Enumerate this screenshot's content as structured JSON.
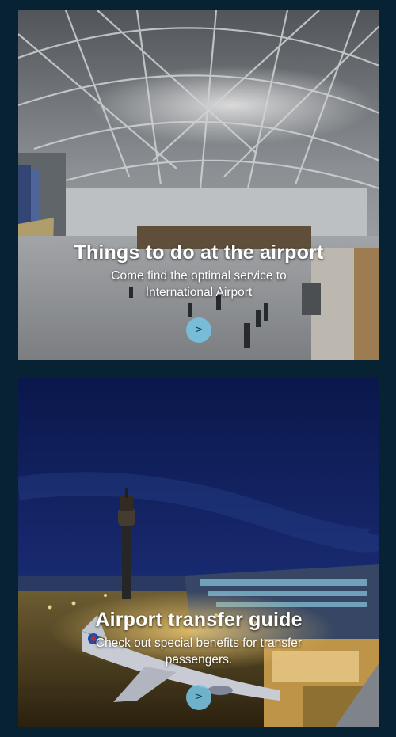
{
  "cards": [
    {
      "title": "Things to do at the airport",
      "subtitle": "Come find the optimal service to International Airport",
      "button_label": ">"
    },
    {
      "title": "Airport transfer guide",
      "subtitle": "Check out special benefits for transfer passengers.",
      "button_label": ">"
    }
  ],
  "colors": {
    "page_background": "#062233",
    "button_fill": "#76c4e2",
    "night_sky": "#152a6e",
    "terminal_lights": "#f2b84a"
  },
  "images": [
    {
      "icon": "airport-terminal-interior-photo"
    },
    {
      "icon": "airport-control-tower-night-photo"
    }
  ]
}
